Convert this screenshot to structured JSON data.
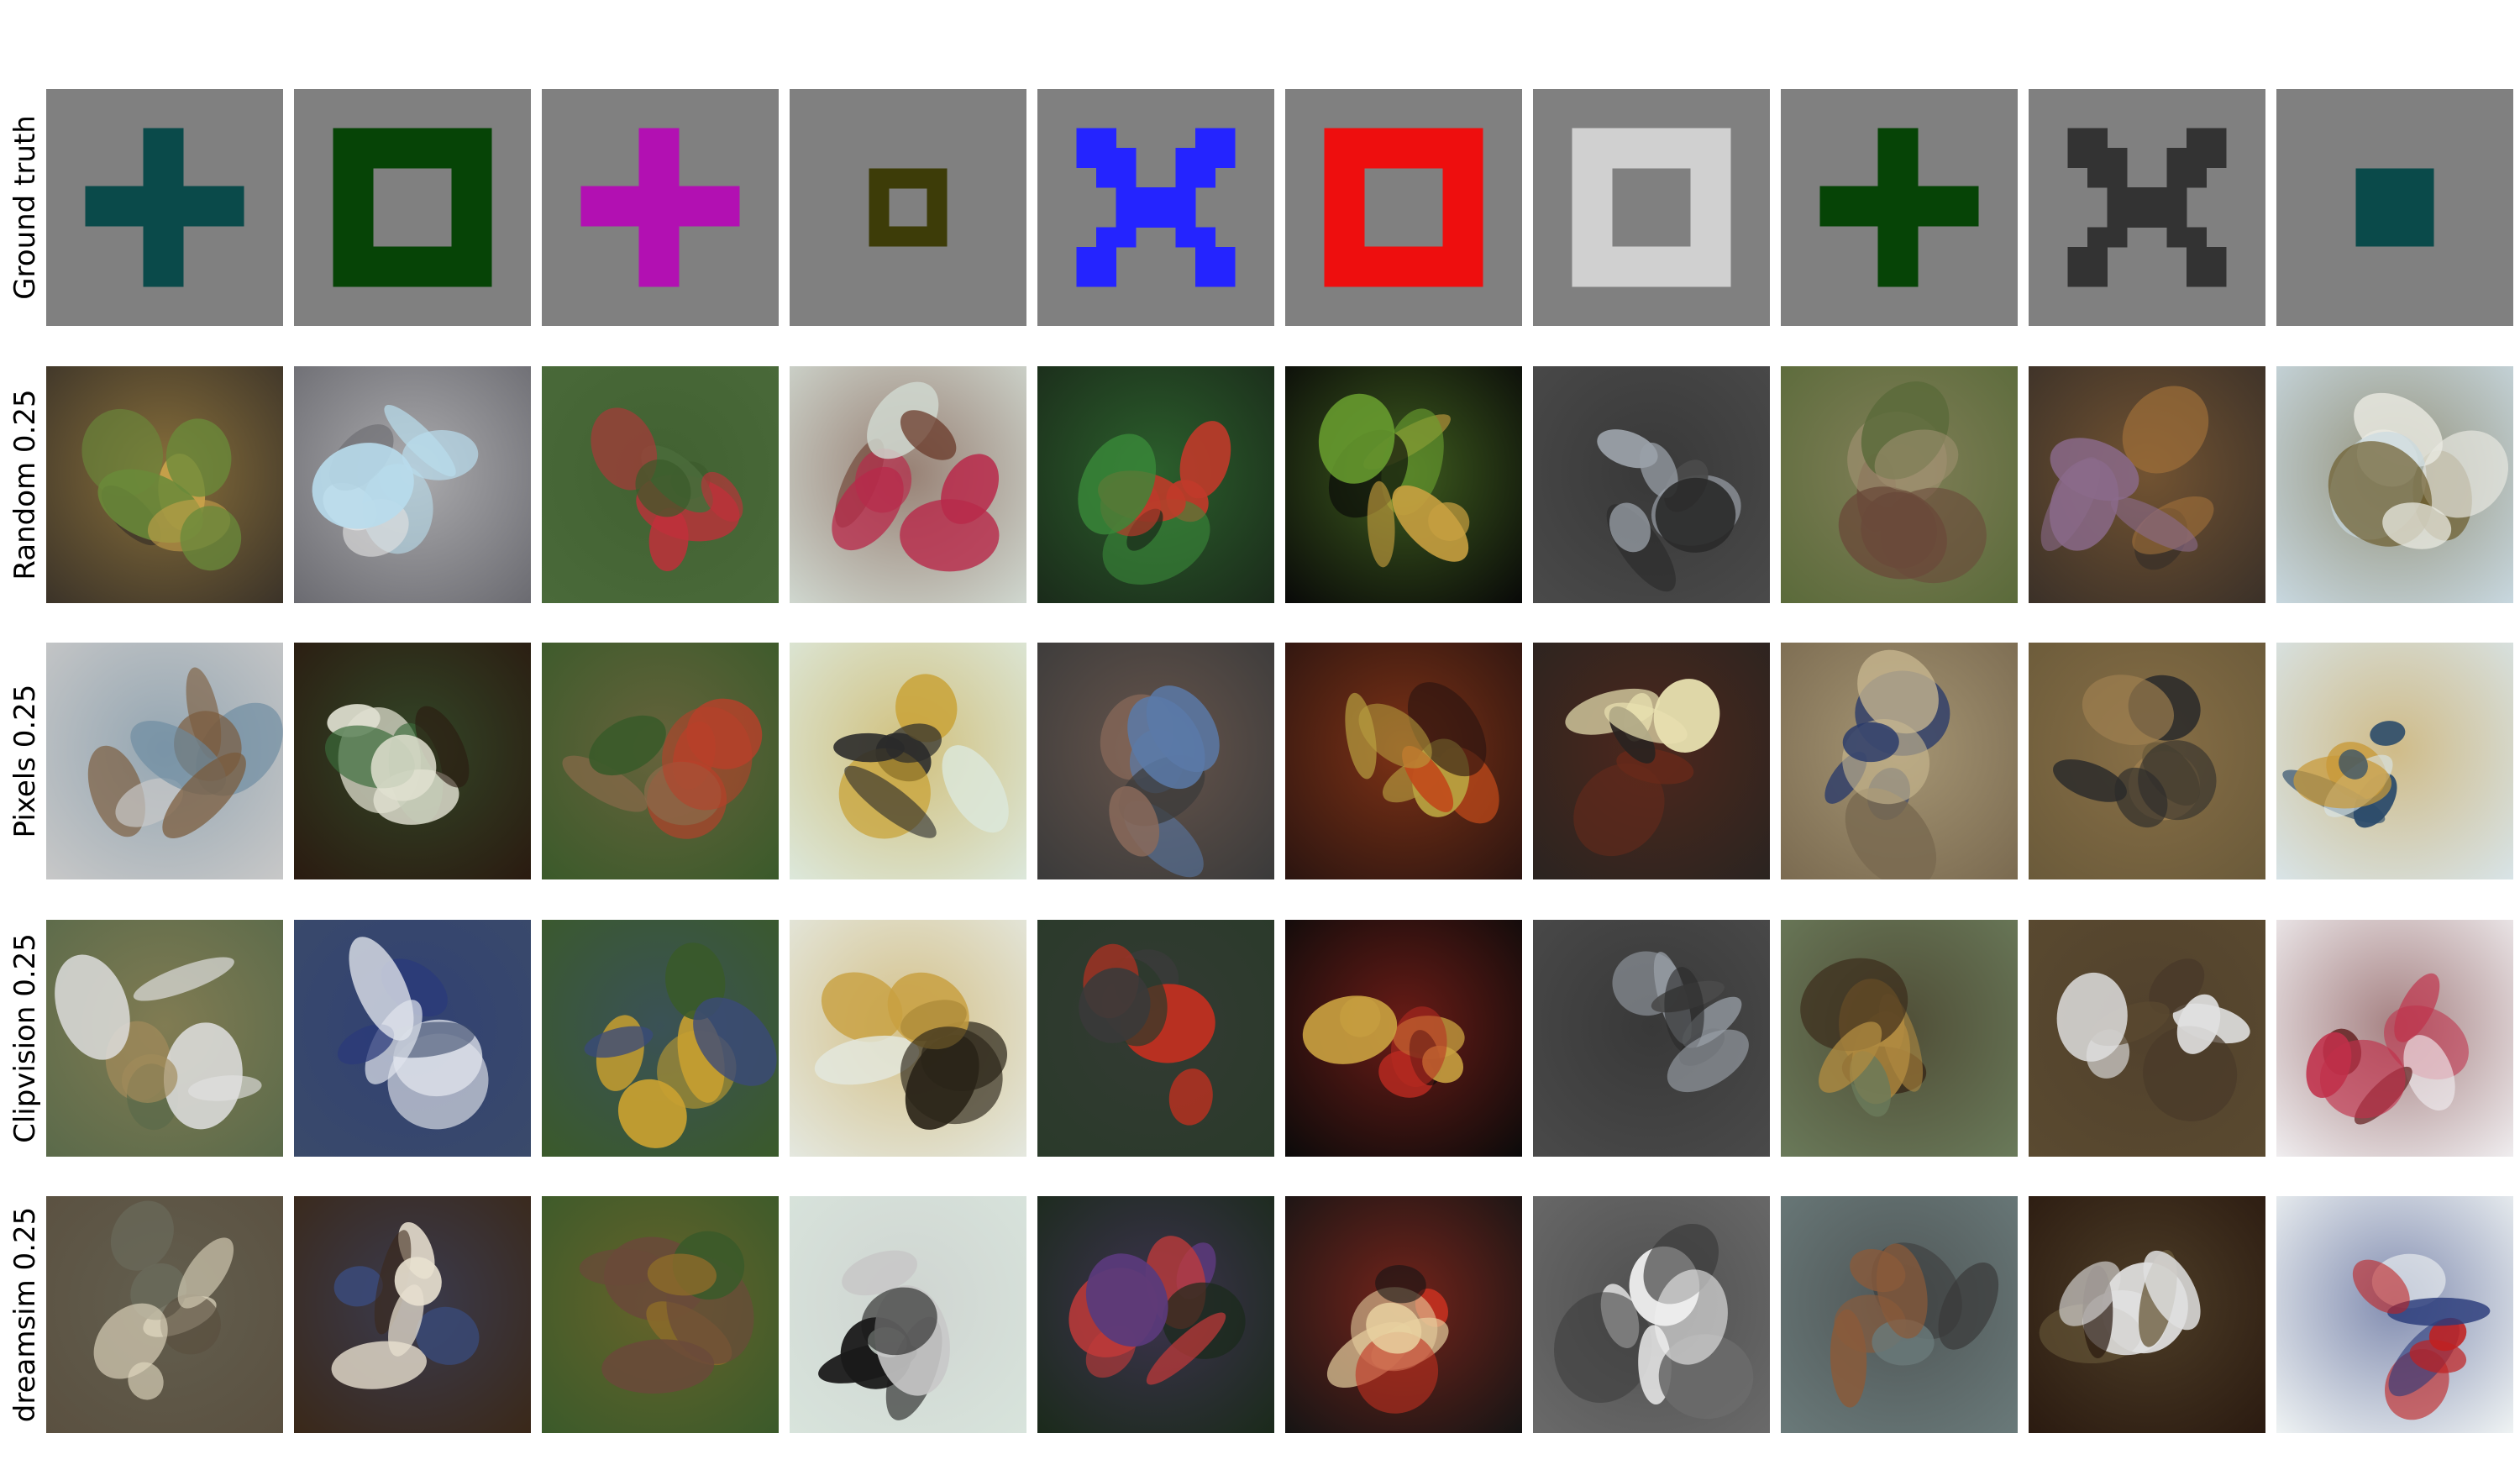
{
  "rows": [
    {
      "label": "Ground truth"
    },
    {
      "label": "Random 0.25"
    },
    {
      "label": "Pixels 0.25"
    },
    {
      "label": "Clipvision 0.25"
    },
    {
      "label": "dreamsim 0.25"
    }
  ],
  "ground_truth": [
    {
      "shape": "plus-icon",
      "color": "#0a4a4a",
      "bg": "#808080"
    },
    {
      "shape": "square-ring-icon",
      "color": "#064406",
      "bg": "#808080"
    },
    {
      "shape": "plus-icon",
      "color": "#b210b2",
      "bg": "#808080"
    },
    {
      "shape": "small-square-ring-icon",
      "color": "#3d3c08",
      "bg": "#808080"
    },
    {
      "shape": "x-icon",
      "color": "#2424ff",
      "bg": "#808080"
    },
    {
      "shape": "square-ring-icon",
      "color": "#ee0e0e",
      "bg": "#808080"
    },
    {
      "shape": "square-ring-icon",
      "color": "#d0d0d0",
      "bg": "#808080"
    },
    {
      "shape": "plus-icon",
      "color": "#064406",
      "bg": "#808080"
    },
    {
      "shape": "x-icon",
      "color": "#333333",
      "bg": "#808080"
    },
    {
      "shape": "filled-square-icon",
      "color": "#0a4a4a",
      "bg": "#808080"
    }
  ],
  "photos": [
    [
      {
        "bg": "#3a3228",
        "fg": "#6a8a3a",
        "accent": "#c9a24a"
      },
      {
        "bg": "#6a6a70",
        "fg": "#b8dcec",
        "accent": "#e0e0e0"
      },
      {
        "bg": "#4a6a3a",
        "fg": "#c0303a",
        "accent": "#3a5a2a"
      },
      {
        "bg": "#d0d8d0",
        "fg": "#b82a4a",
        "accent": "#6a3a2a"
      },
      {
        "bg": "#1a2a1a",
        "fg": "#c03a2a",
        "accent": "#3a8a3a"
      },
      {
        "bg": "#080808",
        "fg": "#c8a040",
        "accent": "#6aa030"
      },
      {
        "bg": "#4a4a4a",
        "fg": "#9aa0a8",
        "accent": "#2a2a2a"
      },
      {
        "bg": "#5a6a3a",
        "fg": "#6a4a3a",
        "accent": "#a09070"
      },
      {
        "bg": "#3a3028",
        "fg": "#8a6a8a",
        "accent": "#a0703a"
      },
      {
        "bg": "#c8d8e0",
        "fg": "#e8e8e0",
        "accent": "#6a5a2a"
      }
    ],
    [
      {
        "bg": "#c8c8c8",
        "fg": "#7a5a3a",
        "accent": "#6a8aa0"
      },
      {
        "bg": "#2a1a10",
        "fg": "#e0e0d0",
        "accent": "#3a6a3a"
      },
      {
        "bg": "#3a5a2a",
        "fg": "#b8402a",
        "accent": "#8a6a4a"
      },
      {
        "bg": "#dce8dc",
        "fg": "#2a2a2a",
        "accent": "#c8a030"
      },
      {
        "bg": "#3a3a3a",
        "fg": "#5a7aa8",
        "accent": "#8a6a5a"
      },
      {
        "bg": "#2a1410",
        "fg": "#b8a040",
        "accent": "#c04a1a"
      },
      {
        "bg": "#2a2420",
        "fg": "#e8e0b0",
        "accent": "#6a2a1a"
      },
      {
        "bg": "#7a6a50",
        "fg": "#2a3a6a",
        "accent": "#c8b890"
      },
      {
        "bg": "#6a5a3a",
        "fg": "#2a2a2a",
        "accent": "#a08050"
      },
      {
        "bg": "#d8e4e8",
        "fg": "#2a4a6a",
        "accent": "#c89a3a"
      }
    ],
    [
      {
        "bg": "#5a6a4a",
        "fg": "#e0e0e0",
        "accent": "#a08a5a"
      },
      {
        "bg": "#3a4a6a",
        "fg": "#e0e4ec",
        "accent": "#2a3a7a"
      },
      {
        "bg": "#3a5a2a",
        "fg": "#c8a030",
        "accent": "#3a4a7a"
      },
      {
        "bg": "#e4e8e0",
        "fg": "#2a2418",
        "accent": "#c8a040"
      },
      {
        "bg": "#2a3a2a",
        "fg": "#c03020",
        "accent": "#3a3a3a"
      },
      {
        "bg": "#0a0a0a",
        "fg": "#c8a040",
        "accent": "#b82a20"
      },
      {
        "bg": "#4a4a4a",
        "fg": "#9aa0a8",
        "accent": "#2a2a2a"
      },
      {
        "bg": "#6a7a5a",
        "fg": "#b08a40",
        "accent": "#3a2a1a"
      },
      {
        "bg": "#5a4a30",
        "fg": "#e0e0e0",
        "accent": "#4a3a2a"
      },
      {
        "bg": "#f0eef0",
        "fg": "#c0304a",
        "accent": "#6a2a2a"
      }
    ],
    [
      {
        "bg": "#5a5040",
        "fg": "#e0d8c0",
        "accent": "#6a6a5a"
      },
      {
        "bg": "#3a2818",
        "fg": "#e8e0d0",
        "accent": "#3a4a7a"
      },
      {
        "bg": "#3a5a2a",
        "fg": "#6a4a3a",
        "accent": "#8a6a2a"
      },
      {
        "bg": "#d8e4dc",
        "fg": "#1a1a1a",
        "accent": "#c8c8c8"
      },
      {
        "bg": "#1a2a1a",
        "fg": "#c03a3a",
        "accent": "#5a3a7a"
      },
      {
        "bg": "#141414",
        "fg": "#e8d0a0",
        "accent": "#c03020"
      },
      {
        "bg": "#6a6a6a",
        "fg": "#f0f0f0",
        "accent": "#3a3a3a"
      },
      {
        "bg": "#6a7a7a",
        "fg": "#8a5a3a",
        "accent": "#3a3a3a"
      },
      {
        "bg": "#2a1a10",
        "fg": "#e0e0e0",
        "accent": "#6a5a3a"
      },
      {
        "bg": "#f0f4f4",
        "fg": "#c02020",
        "accent": "#2a3a7a"
      }
    ]
  ]
}
